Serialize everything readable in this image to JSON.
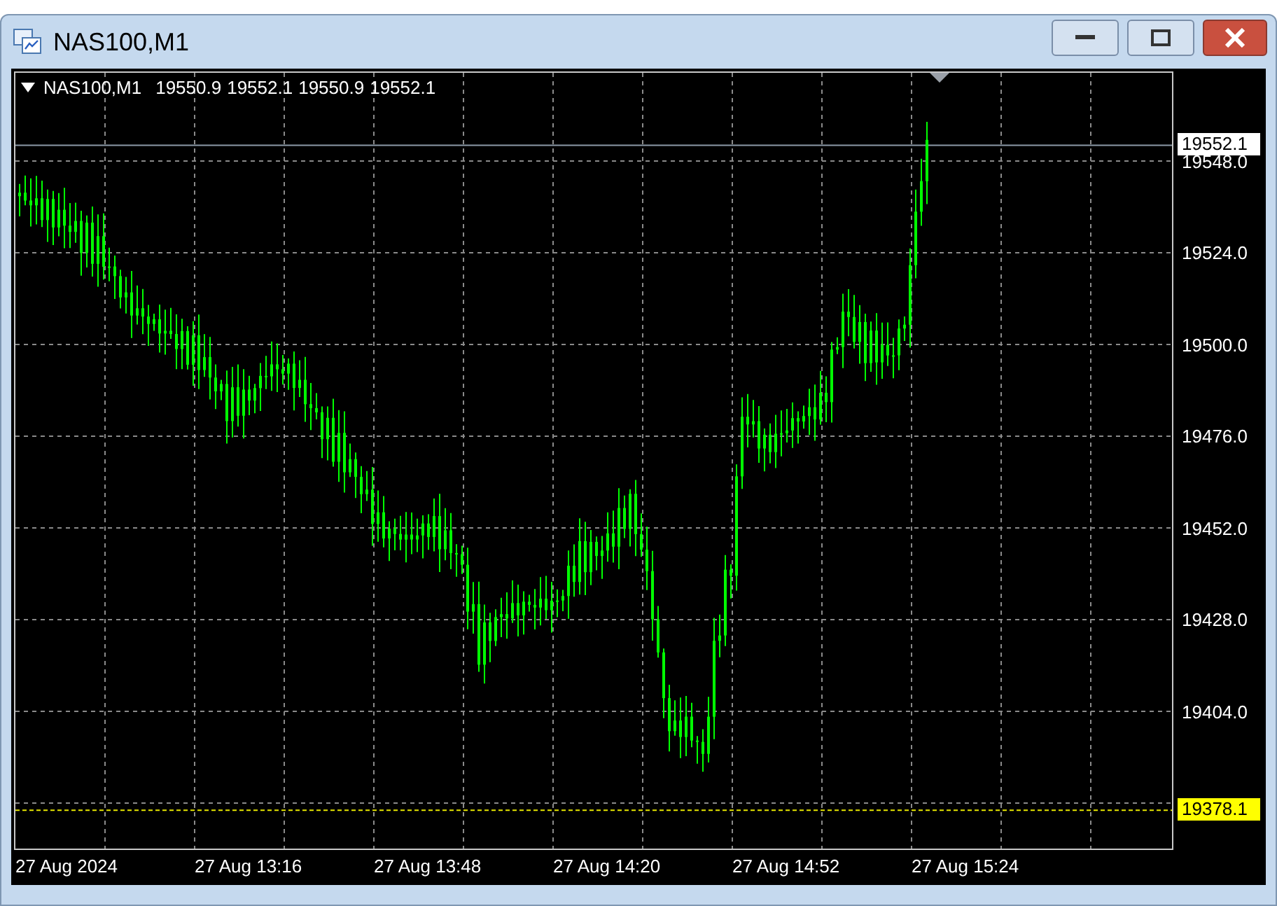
{
  "window": {
    "title": "NAS100,M1"
  },
  "chart": {
    "symbol": "NAS100,M1",
    "quotes": [
      "19550.9",
      "19552.1",
      "19550.9",
      "19552.1"
    ],
    "price_labels": [
      "19548.0",
      "19524.0",
      "19500.0",
      "19476.0",
      "19452.0",
      "19428.0",
      "19404.0"
    ],
    "bid_label": "19552.1",
    "low_label": "19378.1",
    "time_labels": [
      "27 Aug 2024",
      "27 Aug 13:16",
      "27 Aug 13:48",
      "27 Aug 14:20",
      "27 Aug 14:52",
      "27 Aug 15:24"
    ]
  }
}
